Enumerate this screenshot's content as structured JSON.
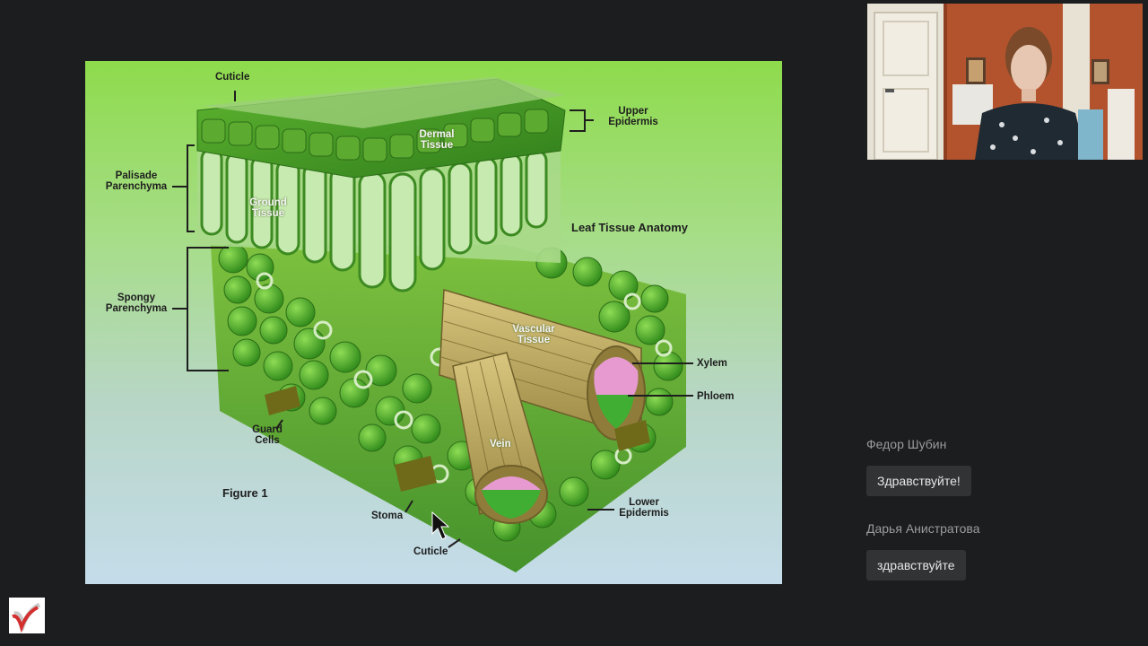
{
  "slide": {
    "labels": {
      "cuticle_top": "Cuticle",
      "upper_epidermis": "Upper Epidermis",
      "dermal_tissue": "Dermal Tissue",
      "palisade_parenchyma": "Palisade Parenchyma",
      "ground_tissue": "Ground Tissue",
      "title": "Leaf Tissue Anatomy",
      "spongy_parenchyma": "Spongy Parenchyma",
      "vascular_tissue": "Vascular Tissue",
      "xylem": "Xylem",
      "phloem": "Phloem",
      "guard_cells": "Guard Cells",
      "vein": "Vein",
      "figure": "Figure 1",
      "lower_epidermis": "Lower Epidermis",
      "stoma": "Stoma",
      "cuticle_bottom": "Cuticle"
    }
  },
  "chat": {
    "messages": [
      {
        "author": "Федор Шубин",
        "text": "Здравствуйте!"
      },
      {
        "author": "Дарья Анистратова",
        "text": "здравствуйте"
      }
    ]
  },
  "icons": {
    "cursor": "mouse-pointer-icon",
    "logo": "app-logo-icon",
    "video": "participant-video"
  }
}
